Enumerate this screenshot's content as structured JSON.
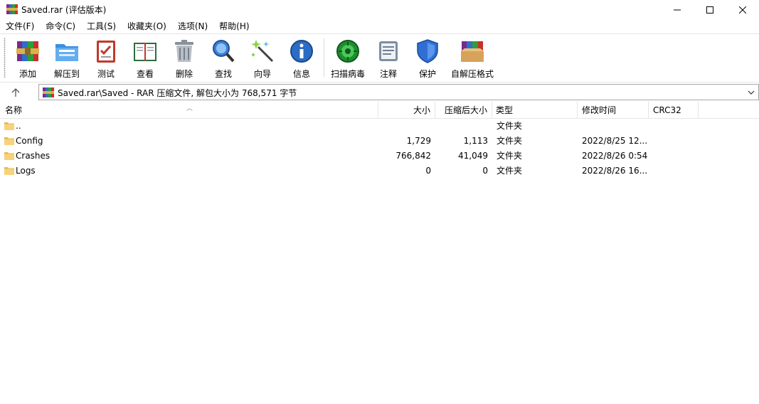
{
  "window": {
    "title": "Saved.rar (评估版本)",
    "icon": "winrar-icon"
  },
  "menu": [
    {
      "label": "文件(F)"
    },
    {
      "label": "命令(C)"
    },
    {
      "label": "工具(S)"
    },
    {
      "label": "收藏夹(O)"
    },
    {
      "label": "选项(N)"
    },
    {
      "label": "帮助(H)"
    }
  ],
  "toolbar": [
    {
      "label": "添加",
      "icon": "add-archive-icon"
    },
    {
      "label": "解压到",
      "icon": "extract-to-icon"
    },
    {
      "label": "测试",
      "icon": "test-icon"
    },
    {
      "label": "查看",
      "icon": "view-book-icon"
    },
    {
      "label": "删除",
      "icon": "trash-icon"
    },
    {
      "label": "查找",
      "icon": "magnifier-icon"
    },
    {
      "label": "向导",
      "icon": "wizard-wand-icon"
    },
    {
      "label": "信息",
      "icon": "info-icon"
    },
    {
      "label": "扫描病毒",
      "icon": "virus-scan-icon"
    },
    {
      "label": "注释",
      "icon": "comment-icon"
    },
    {
      "label": "保护",
      "icon": "shield-icon"
    },
    {
      "label": "自解压格式",
      "icon": "sfx-box-icon"
    }
  ],
  "address": {
    "path": "Saved.rar\\Saved - RAR 压缩文件, 解包大小为 768,571 字节"
  },
  "columns": {
    "name": "名称",
    "size": "大小",
    "packed": "压缩后大小",
    "type": "类型",
    "mtime": "修改时间",
    "crc": "CRC32"
  },
  "rows": [
    {
      "name": "..",
      "size": "",
      "packed": "",
      "type": "文件夹",
      "mtime": "",
      "crc": ""
    },
    {
      "name": "Config",
      "size": "1,729",
      "packed": "1,113",
      "type": "文件夹",
      "mtime": "2022/8/25 12...",
      "crc": ""
    },
    {
      "name": "Crashes",
      "size": "766,842",
      "packed": "41,049",
      "type": "文件夹",
      "mtime": "2022/8/26 0:54",
      "crc": ""
    },
    {
      "name": "Logs",
      "size": "0",
      "packed": "0",
      "type": "文件夹",
      "mtime": "2022/8/26 16...",
      "crc": ""
    }
  ]
}
